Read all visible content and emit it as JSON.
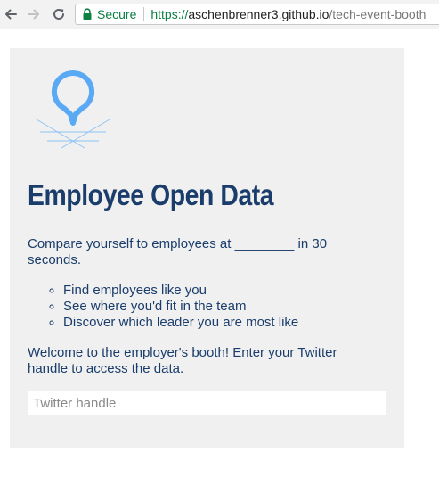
{
  "browser": {
    "secure_label": "Secure",
    "url_scheme": "https://",
    "url_host": "aschenbrenner3.github.io",
    "url_path": "/tech-event-booth",
    "secure_color": "#0b8043"
  },
  "page": {
    "title": "Employee Open Data",
    "intro": "Compare yourself to employees at ________ in 30 seconds.",
    "features": [
      "Find employees like you",
      "See where you'd fit in the team",
      "Discover which leader you are most like"
    ],
    "welcome": "Welcome to the employer's booth! Enter your Twitter handle to access the data.",
    "twitter_input": {
      "placeholder": "Twitter handle",
      "value": ""
    },
    "colors": {
      "heading": "#1a3d6b",
      "logo": "#5aa9f5",
      "card_background": "#f0f0f0"
    },
    "logo_icon": "map-pin-icon"
  }
}
